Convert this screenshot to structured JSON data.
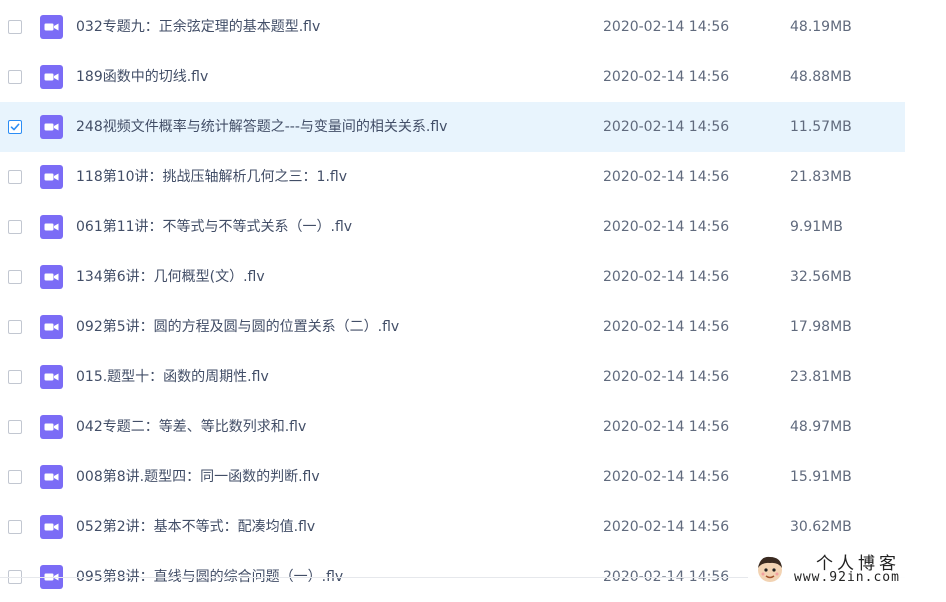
{
  "colors": {
    "accent": "#2b8df5",
    "file_icon": "#7b6cf6",
    "selected_row": "#e8f4fd"
  },
  "files": [
    {
      "name": "032专题九：正余弦定理的基本题型.flv",
      "date": "2020-02-14 14:56",
      "size": "48.19MB",
      "selected": false
    },
    {
      "name": "189函数中的切线.flv",
      "date": "2020-02-14 14:56",
      "size": "48.88MB",
      "selected": false
    },
    {
      "name": "248视频文件概率与统计解答题之---与变量间的相关关系.flv",
      "date": "2020-02-14 14:56",
      "size": "11.57MB",
      "selected": true
    },
    {
      "name": "118第10讲：挑战压轴解析几何之三：1.flv",
      "date": "2020-02-14 14:56",
      "size": "21.83MB",
      "selected": false
    },
    {
      "name": "061第11讲：不等式与不等式关系（一）.flv",
      "date": "2020-02-14 14:56",
      "size": "9.91MB",
      "selected": false
    },
    {
      "name": "134第6讲：几何概型(文）.flv",
      "date": "2020-02-14 14:56",
      "size": "32.56MB",
      "selected": false
    },
    {
      "name": "092第5讲：圆的方程及圆与圆的位置关系（二）.flv",
      "date": "2020-02-14 14:56",
      "size": "17.98MB",
      "selected": false
    },
    {
      "name": "015.题型十：函数的周期性.flv",
      "date": "2020-02-14 14:56",
      "size": "23.81MB",
      "selected": false
    },
    {
      "name": "042专题二：等差、等比数列求和.flv",
      "date": "2020-02-14 14:56",
      "size": "48.97MB",
      "selected": false
    },
    {
      "name": "008第8讲.题型四：同一函数的判断.flv",
      "date": "2020-02-14 14:56",
      "size": "15.91MB",
      "selected": false
    },
    {
      "name": "052第2讲：基本不等式：配凑均值.flv",
      "date": "2020-02-14 14:56",
      "size": "30.62MB",
      "selected": false
    },
    {
      "name": "095第8讲：直线与圆的综合问题（一）.flv",
      "date": "2020-02-14 14:56",
      "size": "",
      "selected": false
    }
  ],
  "watermark": {
    "title": "个人博客",
    "url": "www.92in.com"
  }
}
